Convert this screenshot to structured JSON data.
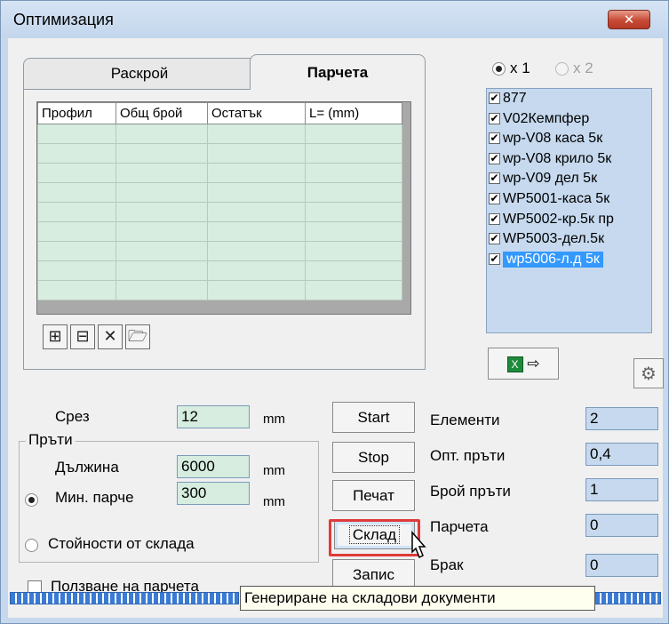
{
  "window": {
    "title": "Оптимизация",
    "close_glyph": "✕"
  },
  "tabs": [
    {
      "label": "Раскрой",
      "active": false
    },
    {
      "label": "Парчета",
      "active": true
    }
  ],
  "grid": {
    "columns": [
      "Профил",
      "Общ брой",
      "Остатък",
      "L= (mm)"
    ],
    "row_count": 9
  },
  "toolbar_icons": [
    "insert-row-icon",
    "insert-row-alt-icon",
    "delete-icon",
    "open-folder-icon"
  ],
  "multiplier": [
    {
      "label": "x 1",
      "selected": true,
      "enabled": true
    },
    {
      "label": "x 2",
      "selected": false,
      "enabled": false
    }
  ],
  "profiles": [
    {
      "label": "877",
      "checked": true
    },
    {
      "label": "V02Кемпфер",
      "checked": true
    },
    {
      "label": "wp-V08 каса 5к",
      "checked": true
    },
    {
      "label": "wp-V08 крило 5к",
      "checked": true
    },
    {
      "label": "wp-V09 дел 5к",
      "checked": true
    },
    {
      "label": "WP5001-каса 5к",
      "checked": true
    },
    {
      "label": "WP5002-кр.5к пр",
      "checked": true
    },
    {
      "label": "WP5003-дел.5к",
      "checked": true
    },
    {
      "label": "wp5006-л.д  5к",
      "checked": true,
      "selected": true
    }
  ],
  "export": {
    "icon": "excel-icon",
    "arrow": "⇨"
  },
  "settings_icon": "gear-icon",
  "cut": {
    "label": "Срез",
    "value": "12",
    "unit": "mm"
  },
  "bars": {
    "group_label": "Пръти",
    "length_label": "Дължина",
    "length_value": "6000",
    "length_unit": "mm",
    "min_piece_label": "Мин. парче",
    "min_piece_value": "300",
    "min_piece_unit": "mm",
    "from_stock_label": "Стойности от склада"
  },
  "use_pieces_label": "Ползване на парчета",
  "buttons": {
    "start": "Start",
    "stop": "Stop",
    "print": "Печат",
    "stock": "Склад",
    "save": "Запис"
  },
  "stats": [
    {
      "label": "Елементи",
      "value": "2"
    },
    {
      "label": "Опт. пръти",
      "value": "0,4"
    },
    {
      "label": "Брой пръти",
      "value": "1"
    },
    {
      "label": "Парчета",
      "value": "0"
    },
    {
      "label": "Брак",
      "value": "0"
    }
  ],
  "tooltip": "Генериране на складови документи",
  "colors": {
    "accent": "#3399ff",
    "highlight": "#e03a3a",
    "field_green": "#d6ede0",
    "field_blue": "#c6d9ee"
  }
}
